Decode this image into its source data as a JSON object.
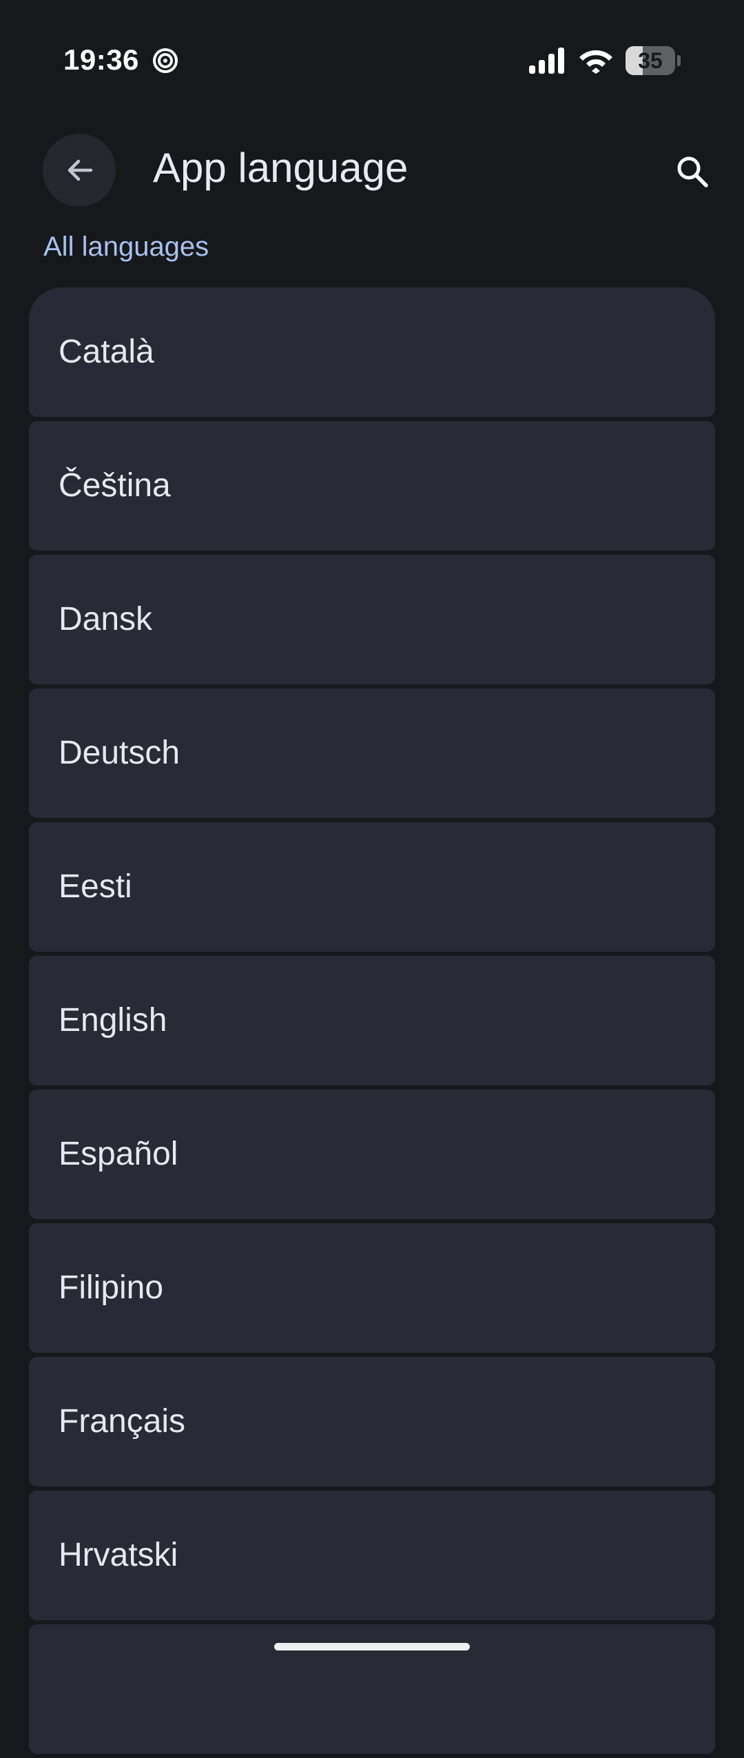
{
  "status_bar": {
    "time": "19:36",
    "battery_level": "35",
    "battery_fraction": 0.35,
    "icons": [
      "spiral-notification-icon",
      "signal-icon",
      "wifi-icon",
      "battery-icon"
    ]
  },
  "top_bar": {
    "title": "App language",
    "back_icon": "arrow-left-icon",
    "search_icon": "search-icon"
  },
  "section": {
    "header": "All languages"
  },
  "languages": [
    "Català",
    "Čeština",
    "Dansk",
    "Deutsch",
    "Eesti",
    "English",
    "Español",
    "Filipino",
    "Français",
    "Hrvatski",
    ""
  ],
  "colors": {
    "background": "#16181c",
    "item_background": "#282b35",
    "accent_text": "#a9c0ec",
    "primary_text": "#e6e8f0"
  }
}
